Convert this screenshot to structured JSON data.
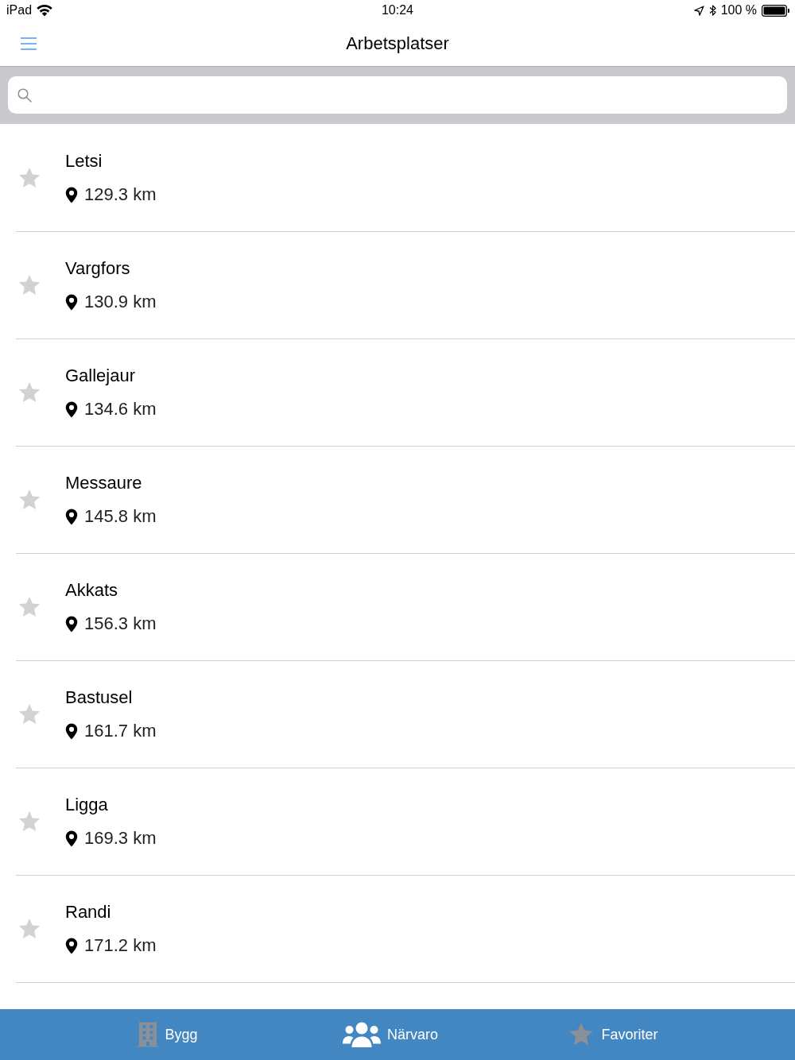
{
  "status_bar": {
    "carrier": "iPad",
    "time": "10:24",
    "battery": "100 %"
  },
  "nav_bar": {
    "title": "Arbetsplatser"
  },
  "workplaces": [
    {
      "name": "Letsi",
      "distance": "129.3 km",
      "favorite": false
    },
    {
      "name": "Vargfors",
      "distance": "130.9 km",
      "favorite": false
    },
    {
      "name": "Gallejaur",
      "distance": "134.6 km",
      "favorite": false
    },
    {
      "name": "Messaure",
      "distance": "145.8 km",
      "favorite": false
    },
    {
      "name": "Akkats",
      "distance": "156.3 km",
      "favorite": false
    },
    {
      "name": "Bastusel",
      "distance": "161.7 km",
      "favorite": false
    },
    {
      "name": "Ligga",
      "distance": "169.3 km",
      "favorite": false
    },
    {
      "name": "Randi",
      "distance": "171.2 km",
      "favorite": false
    }
  ],
  "tab_bar": [
    {
      "label": "Bygg",
      "kind": "building",
      "selected": false
    },
    {
      "label": "Närvaro",
      "kind": "people",
      "selected": true
    },
    {
      "label": "Favoriter",
      "kind": "star",
      "selected": false
    }
  ]
}
